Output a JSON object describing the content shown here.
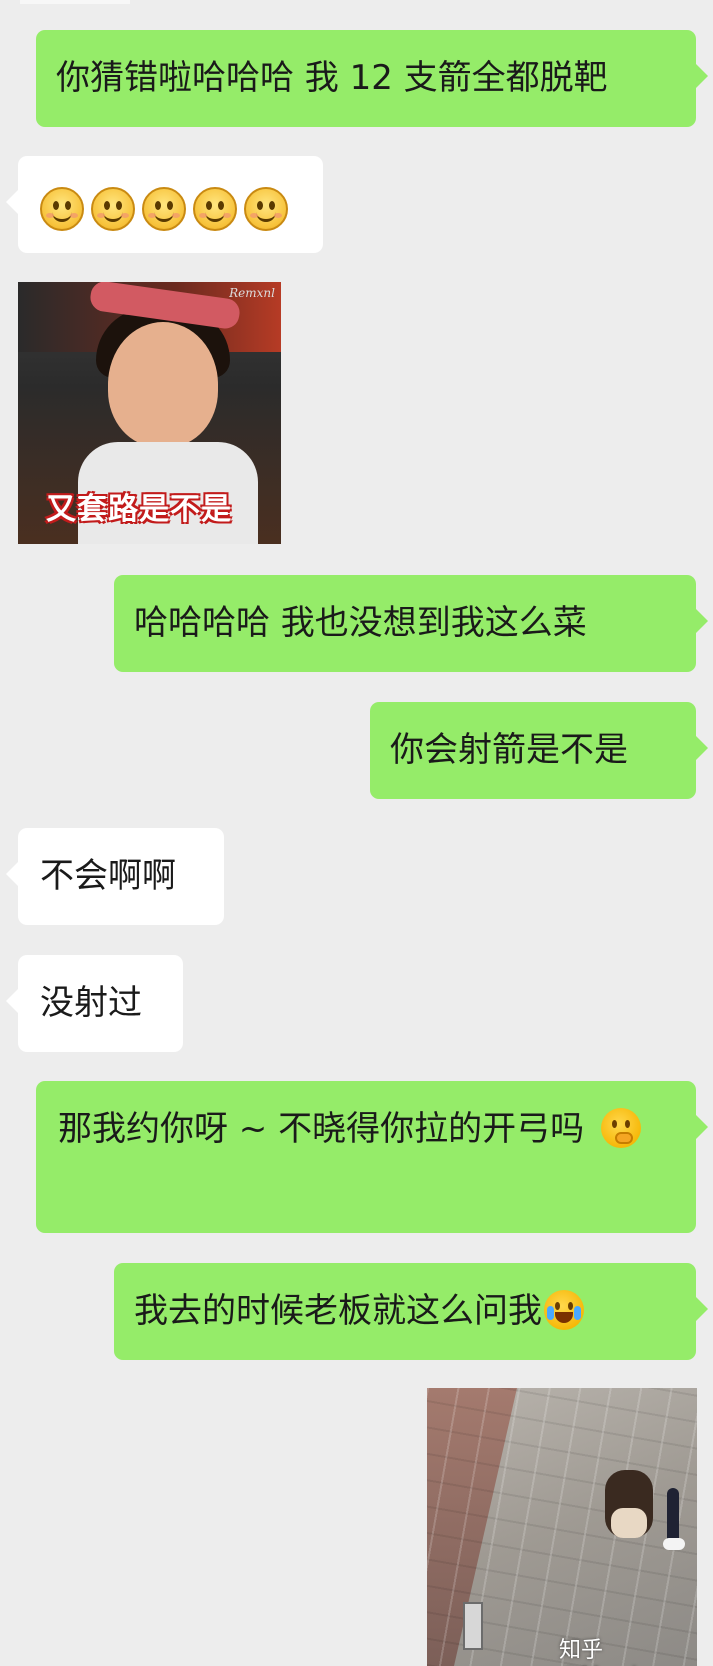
{
  "messages": [
    {
      "side": "sent",
      "text": "你猜错啦哈哈哈 我 12 支箭全都脱靶"
    },
    {
      "side": "recv",
      "emoji_row": [
        "smile-emoji",
        "smile-emoji",
        "smile-emoji",
        "smile-emoji",
        "smile-emoji"
      ]
    },
    {
      "side": "recv",
      "image_caption": "又套路是不是",
      "image_watermark": "Remxnl"
    },
    {
      "side": "sent",
      "text": "哈哈哈哈 我也没想到我这么菜"
    },
    {
      "side": "sent",
      "text": "你会射箭是不是"
    },
    {
      "side": "recv",
      "text": "不会啊啊"
    },
    {
      "side": "recv",
      "text": "没射过"
    },
    {
      "side": "sent",
      "text": "那我约你呀 ~ 不晓得你拉的开弓吗",
      "emoji": "thinking-face-emoji"
    },
    {
      "side": "sent",
      "text": "我去的时候老板就这么问我",
      "emoji": "loudly-crying-face-emoji"
    },
    {
      "side": "sent",
      "image_watermark": "知乎 @Morris"
    }
  ],
  "colors": {
    "background": "#ededed",
    "sent_bubble": "#95ec69",
    "recv_bubble": "#ffffff"
  }
}
